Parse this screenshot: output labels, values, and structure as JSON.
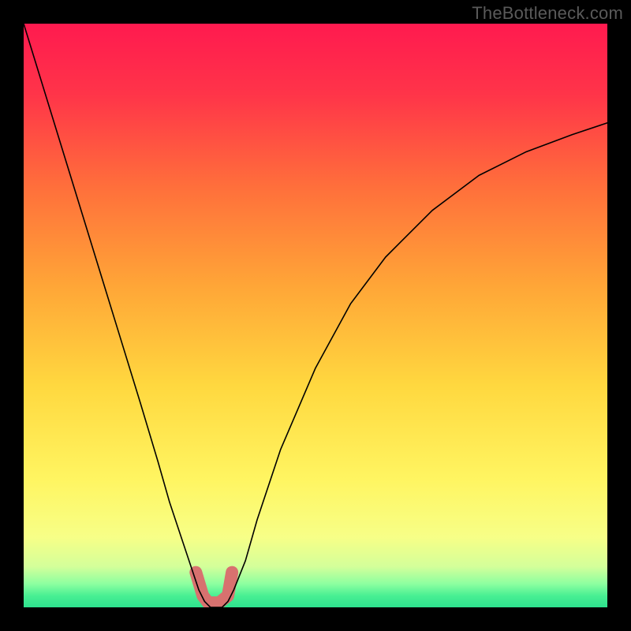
{
  "branding": {
    "watermark_text": "TheBottleneck.com"
  },
  "chart_data": {
    "type": "line",
    "title": "",
    "xlabel": "",
    "ylabel": "",
    "xlim": [
      0,
      100
    ],
    "ylim": [
      0,
      100
    ],
    "grid": false,
    "legend": false,
    "background_gradient": {
      "direction": "vertical",
      "stops": [
        {
          "pos": 0.0,
          "color": "#ff1a4f"
        },
        {
          "pos": 0.12,
          "color": "#ff3449"
        },
        {
          "pos": 0.28,
          "color": "#ff6f3b"
        },
        {
          "pos": 0.45,
          "color": "#ffa637"
        },
        {
          "pos": 0.62,
          "color": "#ffd83f"
        },
        {
          "pos": 0.78,
          "color": "#fff561"
        },
        {
          "pos": 0.88,
          "color": "#f7ff87"
        },
        {
          "pos": 0.93,
          "color": "#d4ff9a"
        },
        {
          "pos": 0.96,
          "color": "#8cffa0"
        },
        {
          "pos": 0.98,
          "color": "#49ef93"
        },
        {
          "pos": 1.0,
          "color": "#2de28e"
        }
      ]
    },
    "series": [
      {
        "name": "bottleneck-curve",
        "color": "#000000",
        "stroke_width": 1.6,
        "x": [
          0,
          4,
          8,
          12,
          16,
          20,
          23,
          25,
          27,
          29,
          30,
          31,
          32,
          33,
          34,
          35,
          36,
          38,
          40,
          44,
          50,
          56,
          62,
          70,
          78,
          86,
          94,
          100
        ],
        "y": [
          100,
          87,
          74,
          61,
          48,
          35,
          25,
          18,
          12,
          6,
          3,
          1,
          0,
          0,
          0,
          1,
          3,
          8,
          15,
          27,
          41,
          52,
          60,
          68,
          74,
          78,
          81,
          83
        ]
      }
    ],
    "markers": [
      {
        "name": "highlight-segment",
        "shape": "round-stroke",
        "color": "#d8716f",
        "stroke_width": 16,
        "x": [
          29.5,
          30.7,
          31.6,
          33.5,
          35.0,
          35.7
        ],
        "y": [
          6.0,
          2.0,
          0.8,
          0.8,
          2.0,
          6.0
        ]
      }
    ]
  }
}
